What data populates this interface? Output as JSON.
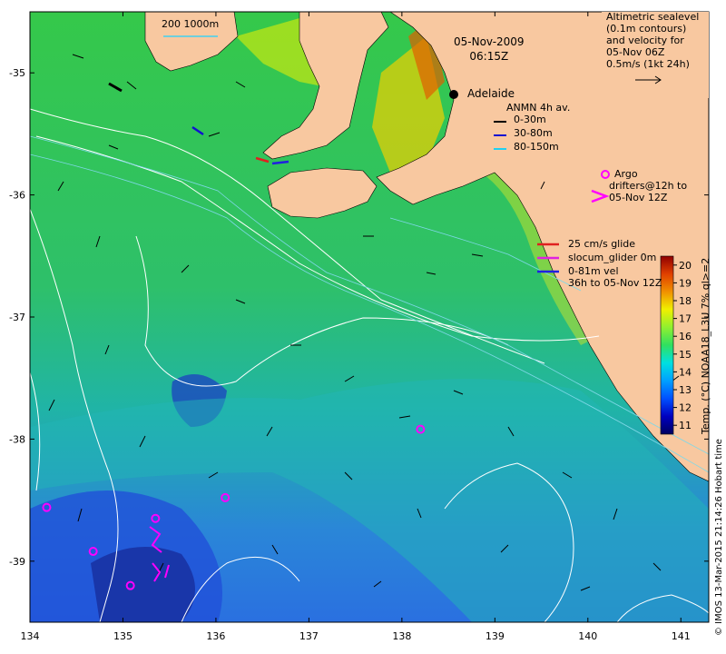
{
  "map": {
    "title_date": "05-Nov-2009",
    "title_time": "06:15Z",
    "city": "Adelaide",
    "scale_label": "200  1000m",
    "x_ticks": [
      "134",
      "135",
      "136",
      "137",
      "138",
      "139",
      "140",
      "141"
    ],
    "y_ticks": [
      "-35",
      "-36",
      "-37",
      "-38",
      "-39"
    ],
    "lon_range": [
      134,
      141.3
    ],
    "lat_range": [
      -39.5,
      -34.5
    ]
  },
  "legend": {
    "sealevel": [
      "Altimetric sealevel",
      "(0.1m contours)",
      "and velocity for",
      "05-Nov 06Z",
      "0.5m/s (1kt 24h)"
    ],
    "anmn_title": "ANMN 4h av.",
    "anmn_items": [
      {
        "label": "0-30m",
        "color": "#000000"
      },
      {
        "label": "30-80m",
        "color": "#1010d0"
      },
      {
        "label": "80-150m",
        "color": "#20d0f0"
      }
    ],
    "argo": [
      "Argo",
      "drifters@12h to",
      "05-Nov 12Z"
    ],
    "glider": [
      "25 cm/s glide",
      "slocum_glider 0m",
      "0-81m vel",
      "36h to 05-Nov 12Z"
    ],
    "glider_colors": [
      "#e02020",
      "#e020e0",
      "#2020e0"
    ],
    "magenta": "#ff00ff"
  },
  "colorbar": {
    "min": 11,
    "max": 20,
    "ticks": [
      "11",
      "12",
      "13",
      "14",
      "15",
      "16",
      "17",
      "18",
      "19",
      "20"
    ],
    "label": "Temp. (°C) NOAA18_L3U 7% ql>=2",
    "colors": [
      "#000060",
      "#0000c0",
      "#0050ff",
      "#00a0ff",
      "#00e0e0",
      "#30e060",
      "#90f030",
      "#f0f000",
      "#f09000",
      "#e04000",
      "#900000"
    ]
  },
  "credit": "© IMOS 13-Mar-2015 21:14:26 Hobart time",
  "argo_floats": [
    {
      "lon": 134.18,
      "lat": -38.56
    },
    {
      "lon": 134.68,
      "lat": -38.92
    },
    {
      "lon": 135.08,
      "lat": -39.2
    },
    {
      "lon": 135.35,
      "lat": -38.65
    },
    {
      "lon": 136.1,
      "lat": -38.48
    },
    {
      "lon": 138.2,
      "lat": -37.92
    }
  ]
}
